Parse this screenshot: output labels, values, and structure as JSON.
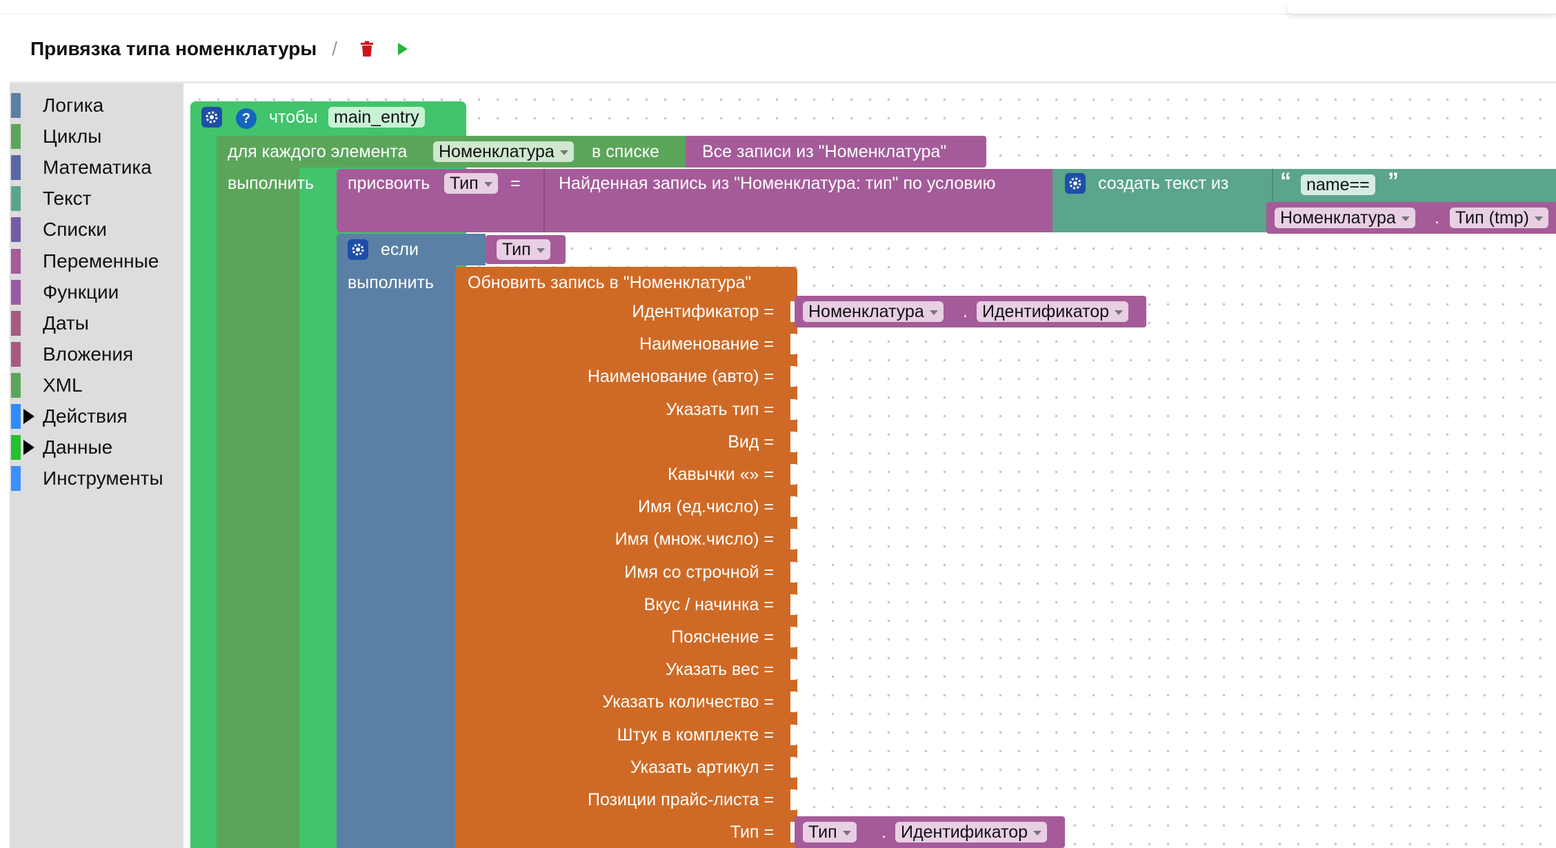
{
  "header": {
    "title": "Привязка типа номенклатуры",
    "separator": "/",
    "delete_icon": "trash-icon",
    "run_icon": "play-icon"
  },
  "toolbox": {
    "categories": [
      {
        "label": "Логика",
        "color": "#5b80a5",
        "expandable": false
      },
      {
        "label": "Циклы",
        "color": "#5ba55b",
        "expandable": false
      },
      {
        "label": "Математика",
        "color": "#5b67a5",
        "expandable": false
      },
      {
        "label": "Текст",
        "color": "#5ba58c",
        "expandable": false
      },
      {
        "label": "Списки",
        "color": "#745ba5",
        "expandable": false
      },
      {
        "label": "Переменные",
        "color": "#a55b99",
        "expandable": false
      },
      {
        "label": "Функции",
        "color": "#995ba5",
        "expandable": false
      },
      {
        "label": "Даты",
        "color": "#a55b80",
        "expandable": false
      },
      {
        "label": "Вложения",
        "color": "#a55b80",
        "expandable": false
      },
      {
        "label": "XML",
        "color": "#5ba55b",
        "expandable": false
      },
      {
        "label": "Действия",
        "color": "#2f8cff",
        "expandable": true
      },
      {
        "label": "Данные",
        "color": "#22c32e",
        "expandable": true
      },
      {
        "label": "Инструменты",
        "color": "#3b8fff",
        "expandable": false
      }
    ]
  },
  "colors": {
    "procedure": "#41c46c",
    "loop": "#5ba55b",
    "variable": "#a55b99",
    "text": "#5ba58c",
    "logic": "#5b80a5",
    "action": "#cf6a26"
  },
  "blocks": {
    "procedure": {
      "prefix": "чтобы",
      "name": "main_entry"
    },
    "foreach": {
      "label": "для каждого элемента",
      "var": "Номенклатура",
      "in_list": "в списке",
      "list": "Все записи из \"Номенклатура\"",
      "do": "выполнить"
    },
    "assign": {
      "label": "присвоить",
      "var": "Тип",
      "eq": "=",
      "find": "Найденная запись из \"Номенклатура: тип\" по условию",
      "create_text": "создать текст из",
      "open_quote": "“",
      "text_value": "name==",
      "close_quote": "”",
      "ref_obj": "Номенклатура",
      "dot": ".",
      "ref_field": "Тип (tmp)"
    },
    "if_block": {
      "label": "если",
      "cond": "Тип",
      "do": "выполнить"
    },
    "update": {
      "title": "Обновить запись в \"Номенклатура\"",
      "fields": [
        {
          "label": "Идентификатор =",
          "obj": "Номенклатура",
          "dot": ".",
          "field": "Идентификатор"
        },
        {
          "label": "Наименование ="
        },
        {
          "label": "Наименование (авто) ="
        },
        {
          "label": "Указать тип ="
        },
        {
          "label": "Вид ="
        },
        {
          "label": "Кавычки «» ="
        },
        {
          "label": "Имя (ед.число) ="
        },
        {
          "label": "Имя (множ.число) ="
        },
        {
          "label": "Имя со строчной ="
        },
        {
          "label": "Вкус / начинка ="
        },
        {
          "label": "Пояснение ="
        },
        {
          "label": "Указать вес ="
        },
        {
          "label": "Указать количество ="
        },
        {
          "label": "Штук в комплекте ="
        },
        {
          "label": "Указать артикул ="
        },
        {
          "label": "Позиции прайс-листа ="
        },
        {
          "label": "Тип =",
          "obj": "Тип",
          "dot": ".",
          "field": "Идентификатор"
        }
      ]
    }
  }
}
